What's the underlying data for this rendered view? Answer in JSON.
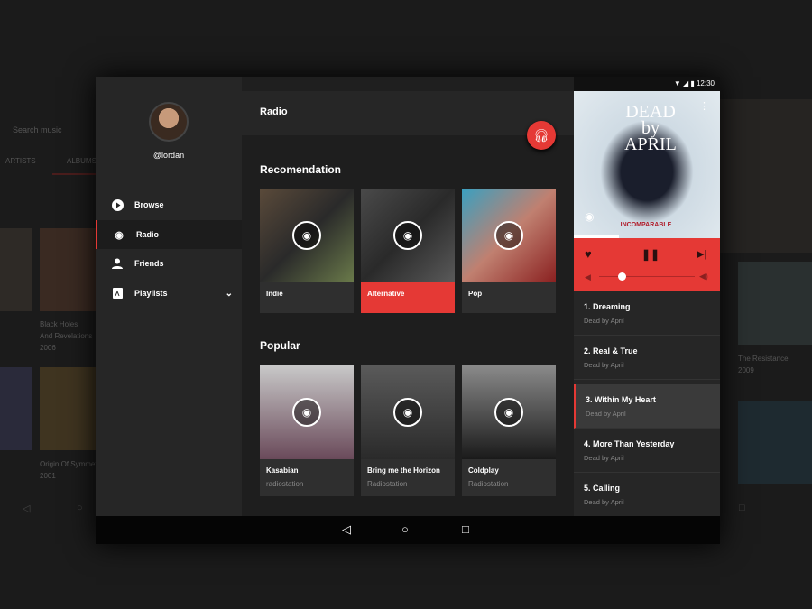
{
  "background_app": {
    "search_placeholder": "Search music",
    "tabs": [
      "ARTISTS",
      "ALBUMS"
    ],
    "albums": [
      {
        "title": "Black Holes",
        "title2": "And Revelations",
        "year": "2006"
      },
      {
        "title": "Origin Of Symmetry",
        "year": "2001"
      },
      {
        "title": "The Resistance",
        "year": "2009"
      }
    ]
  },
  "status_bar": {
    "time": "12:30"
  },
  "sidebar": {
    "username": "@lordan",
    "items": [
      {
        "label": "Browse",
        "icon": "play-circle-icon"
      },
      {
        "label": "Radio",
        "icon": "radio-icon",
        "active": true
      },
      {
        "label": "Friends",
        "icon": "person-icon"
      },
      {
        "label": "Playlists",
        "icon": "playlist-icon"
      }
    ]
  },
  "main": {
    "title": "Radio",
    "sections": [
      {
        "title": "Recomendation",
        "cards": [
          {
            "title": "Indie"
          },
          {
            "title": "Alternative",
            "selected": true
          },
          {
            "title": "Pop"
          }
        ]
      },
      {
        "title": "Popular",
        "cards": [
          {
            "title": "Kasabian",
            "subtitle": "radiostation"
          },
          {
            "title": "Bring me the Horizon",
            "subtitle": "Radiostation"
          },
          {
            "title": "Coldplay",
            "subtitle": "Radiostation"
          }
        ]
      }
    ]
  },
  "player": {
    "album_text": "DEAD by APRIL",
    "album_sub": "INCOMPARABLE",
    "progress": 0.31,
    "volume": 0.15,
    "accent": "#e53935",
    "tracks": [
      {
        "title": "1. Dreaming",
        "artist": "Dead by April"
      },
      {
        "title": "2. Real & True",
        "artist": "Dead by April"
      },
      {
        "title": "3. Within My Heart",
        "artist": "Dead by April",
        "current": true
      },
      {
        "title": "4. More Than Yesterday",
        "artist": "Dead by April"
      },
      {
        "title": "5. Calling",
        "artist": "Dead by April"
      }
    ]
  }
}
